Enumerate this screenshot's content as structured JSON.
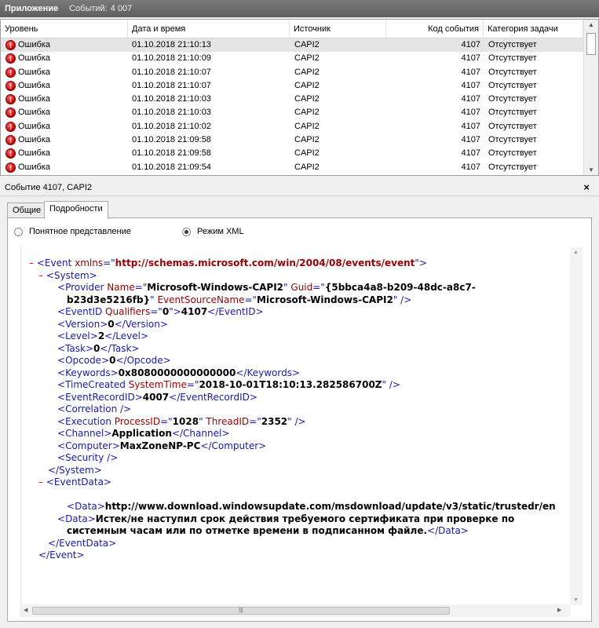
{
  "titlebar": {
    "app": "Приложение",
    "count_label": "Событий:",
    "count_value": "4 007"
  },
  "events_table": {
    "columns": [
      "Уровень",
      "Дата и время",
      "Источник",
      "Код события",
      "Категория задачи"
    ],
    "rows": [
      {
        "level": "Ошибка",
        "datetime": "01.10.2018 21:10:13",
        "source": "CAPI2",
        "event_id": "4107",
        "category": "Отсутствует"
      },
      {
        "level": "Ошибка",
        "datetime": "01.10.2018 21:10:09",
        "source": "CAPI2",
        "event_id": "4107",
        "category": "Отсутствует"
      },
      {
        "level": "Ошибка",
        "datetime": "01.10.2018 21:10:07",
        "source": "CAPI2",
        "event_id": "4107",
        "category": "Отсутствует"
      },
      {
        "level": "Ошибка",
        "datetime": "01.10.2018 21:10:07",
        "source": "CAPI2",
        "event_id": "4107",
        "category": "Отсутствует"
      },
      {
        "level": "Ошибка",
        "datetime": "01.10.2018 21:10:03",
        "source": "CAPI2",
        "event_id": "4107",
        "category": "Отсутствует"
      },
      {
        "level": "Ошибка",
        "datetime": "01.10.2018 21:10:03",
        "source": "CAPI2",
        "event_id": "4107",
        "category": "Отсутствует"
      },
      {
        "level": "Ошибка",
        "datetime": "01.10.2018 21:10:02",
        "source": "CAPI2",
        "event_id": "4107",
        "category": "Отсутствует"
      },
      {
        "level": "Ошибка",
        "datetime": "01.10.2018 21:09:58",
        "source": "CAPI2",
        "event_id": "4107",
        "category": "Отсутствует"
      },
      {
        "level": "Ошибка",
        "datetime": "01.10.2018 21:09:58",
        "source": "CAPI2",
        "event_id": "4107",
        "category": "Отсутствует"
      },
      {
        "level": "Ошибка",
        "datetime": "01.10.2018 21:09:54",
        "source": "CAPI2",
        "event_id": "4107",
        "category": "Отсутствует"
      }
    ],
    "level_icon": "error-icon"
  },
  "detail": {
    "title": "Событие 4107, CAPI2",
    "close": "×",
    "tabs": [
      "Общие",
      "Подробности"
    ],
    "active_tab": "Подробности",
    "view_options": {
      "friendly": "Понятное представление",
      "xml": "Режим XML",
      "selected": "xml"
    }
  },
  "xml": {
    "event_open": {
      "tag": "Event",
      "attr": "xmlns",
      "value": "http://schemas.microsoft.com/win/2004/08/events/event"
    },
    "system_tag": "System",
    "provider": {
      "tag": "Provider",
      "name_attr": "Name",
      "name": "Microsoft-Windows-CAPI2",
      "guid_attr": "Guid",
      "guid_part1": "{5bbca4a8-b209-48dc-a8c7-",
      "guid_part2": "b23d3e5216fb}",
      "esn_attr": "EventSourceName",
      "esn": "Microsoft-Windows-CAPI2"
    },
    "eventid": {
      "tag": "EventID",
      "attr": "Qualifiers",
      "attr_value": "0",
      "value": "4107"
    },
    "version": {
      "tag": "Version",
      "value": "0"
    },
    "level": {
      "tag": "Level",
      "value": "2"
    },
    "task": {
      "tag": "Task",
      "value": "0"
    },
    "opcode": {
      "tag": "Opcode",
      "value": "0"
    },
    "keywords": {
      "tag": "Keywords",
      "value": "0x8080000000000000"
    },
    "timecreated": {
      "tag": "TimeCreated",
      "attr": "SystemTime",
      "value": "2018-10-01T18:10:13.282586700Z"
    },
    "recordid": {
      "tag": "EventRecordID",
      "value": "4007"
    },
    "correlation": {
      "tag": "Correlation"
    },
    "execution": {
      "tag": "Execution",
      "pid_attr": "ProcessID",
      "pid": "1028",
      "tid_attr": "ThreadID",
      "tid": "2352"
    },
    "channel": {
      "tag": "Channel",
      "value": "Application"
    },
    "computer": {
      "tag": "Computer",
      "value": "MaxZoneNP-PC"
    },
    "security": {
      "tag": "Security"
    },
    "eventdata_tag": "EventData",
    "data1": {
      "tag": "Data",
      "value": "http://www.download.windowsupdate.com/msdownload/update/v3/static/trustedr/en"
    },
    "data2": {
      "tag": "Data",
      "value_line1": "Истек/не наступил срок действия требуемого сертификата при проверке по",
      "value_line2": "системным часам или по отметке времени в подписанном файле."
    }
  }
}
